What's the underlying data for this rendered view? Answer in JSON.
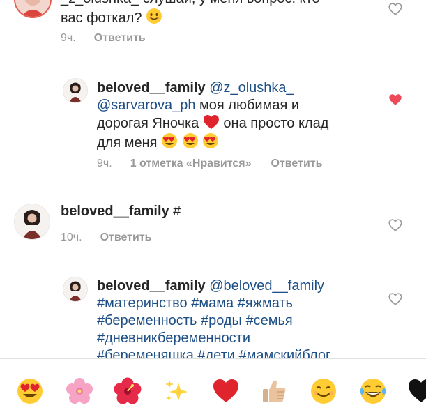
{
  "comments": [
    {
      "time": "9ч.",
      "reply_label": "Ответить",
      "text_tail_1": "_z_olushka_ слушай, у меня вопрос: кто",
      "text_tail_2": "вас фоткал?",
      "liked": false
    },
    {
      "username": "beloved__family",
      "mention_1": "@z_olushka_",
      "mention_2": "@sarvarova_ph",
      "text_1": " моя любимая и",
      "text_2": "дорогая Яночка ",
      "text_3": " она просто клад",
      "text_4": "для меня ",
      "time": "9ч.",
      "likes": "1 отметка «Нравится»",
      "reply_label": "Ответить",
      "liked": true
    },
    {
      "username": "beloved__family",
      "text": " #",
      "time": "10ч.",
      "reply_label": "Ответить",
      "liked": false
    },
    {
      "username": "beloved__family",
      "mention": "@beloved__family",
      "tags_1": "#материнство #мама #яжмать",
      "tags_2": "#беременность #роды #семья",
      "tags_3": "#дневникбеременности",
      "tags_4": "#беременяшка #дети #мамскийблог",
      "liked": false
    }
  ],
  "emoji_bar": [
    "heart-eyes",
    "cherry-blossom",
    "hibiscus",
    "sparkles",
    "red-heart",
    "thumbs-up",
    "smiling-face",
    "tears-of-joy",
    "black-heart"
  ],
  "colors": {
    "heart_red": "#ed4956",
    "link": "#1d4f86",
    "meta": "#999999"
  }
}
